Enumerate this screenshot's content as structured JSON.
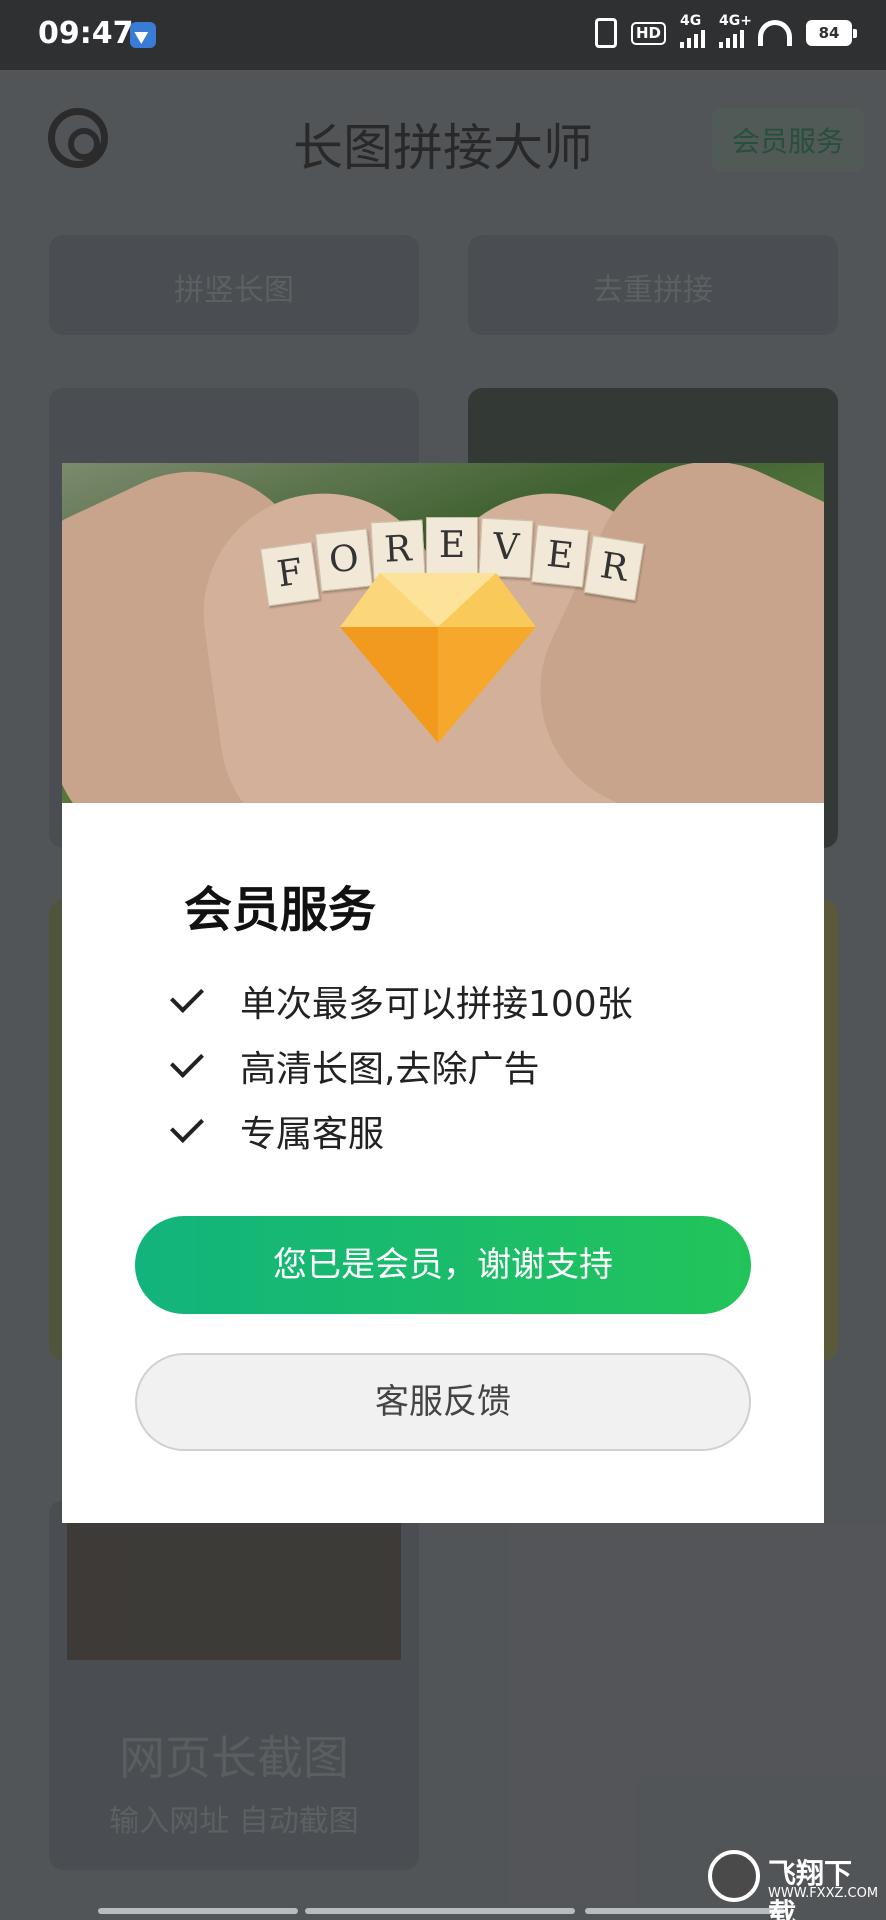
{
  "status_bar": {
    "time": "09:47",
    "battery": "84",
    "network_1": "4G",
    "network_2": "4G+",
    "hd_badge": "HD"
  },
  "header": {
    "title": "长图拼接大师",
    "member_button": "会员服务"
  },
  "background_cards": {
    "card1_subtitle": "拼竖长图",
    "card2_subtitle": "去重拼接",
    "webpage_title": "网页长截图",
    "webpage_subtitle": "输入网址 自动截图"
  },
  "dialog": {
    "banner_text": [
      "F",
      "O",
      "R",
      "E",
      "V",
      "E",
      "R"
    ],
    "title": "会员服务",
    "features": [
      "单次最多可以拼接100张",
      "高清长图,去除广告",
      "专属客服"
    ],
    "primary_button": "您已是会员，谢谢支持",
    "secondary_button": "客服反馈"
  },
  "colors": {
    "primary_green_start": "#12b47c",
    "primary_green_end": "#22c45a",
    "diamond": "#f5a623"
  },
  "watermark": {
    "name": "飞翔下载",
    "url": "WWW.FXXZ.COM"
  }
}
